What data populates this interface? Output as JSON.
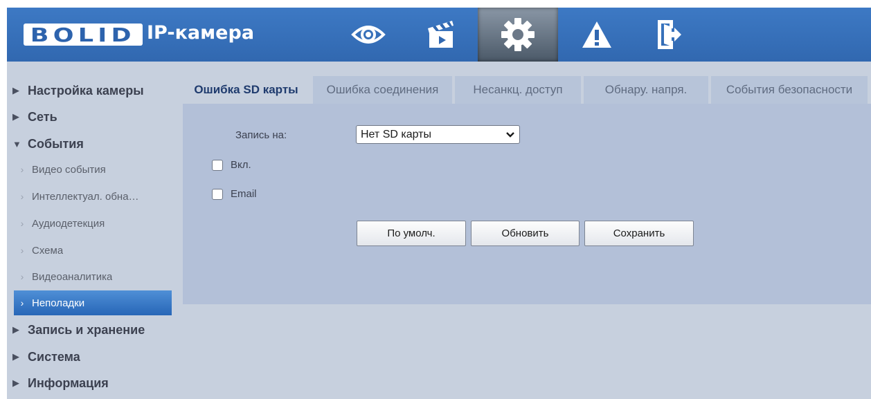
{
  "header": {
    "logo": "BOLID",
    "title": "IP-камера",
    "nav_icons": [
      "eye-icon",
      "clapperboard-icon",
      "gear-icon",
      "warning-icon",
      "exit-door-icon"
    ],
    "active_icon": "gear-icon"
  },
  "sidebar": {
    "camera_settings": "Настройка камеры",
    "network": "Сеть",
    "events": "События",
    "events_items": [
      "Видео события",
      "Интеллектуал. обна…",
      "Аудиодетекция",
      "Схема",
      "Видеоаналитика",
      "Неполадки"
    ],
    "active_item": "Неполадки",
    "record_storage": "Запись и хранение",
    "system": "Система",
    "info": "Информация"
  },
  "tabs": [
    "Ошибка SD карты",
    "Ошибка соединения",
    "Несанкц. доступ",
    "Обнару. напря.",
    "События безопасности"
  ],
  "active_tab": "Ошибка SD карты",
  "form": {
    "record_label": "Запись на:",
    "record_value": "Нет SD карты",
    "enable_label": "Вкл.",
    "email_label": "Email",
    "enable_checked": false,
    "email_checked": false
  },
  "buttons": {
    "default": "По умолч.",
    "refresh": "Обновить",
    "save": "Сохранить"
  },
  "colors": {
    "header_blue": "#3168b0",
    "background": "#c7d0de",
    "panel": "#b3c0d8",
    "active_item": "#2766b7"
  }
}
